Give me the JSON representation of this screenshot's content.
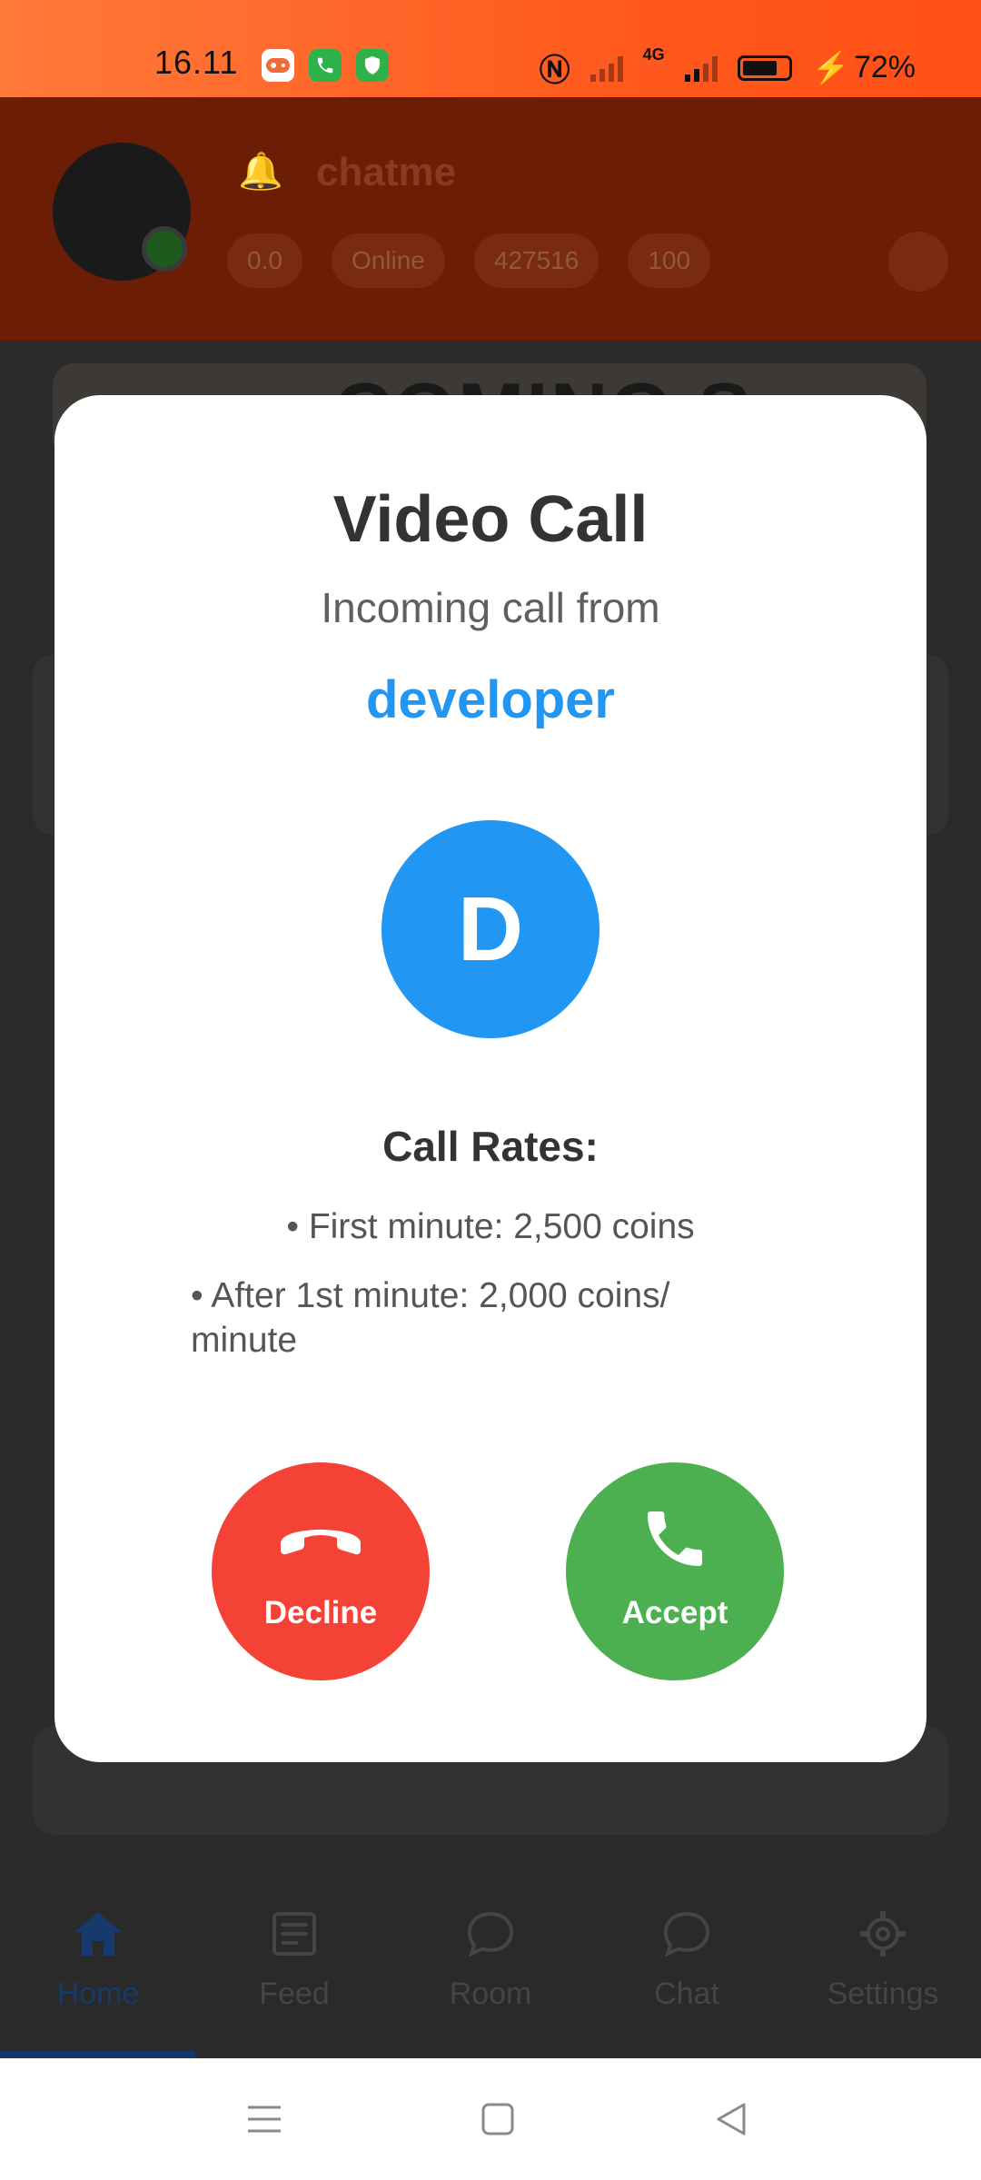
{
  "status_bar": {
    "time": "16.11",
    "battery": "72%",
    "network": "4G"
  },
  "background_app": {
    "title": "chatme",
    "chips": [
      "0.0",
      "Online",
      "427516",
      "100"
    ],
    "banner_text": "COMING S",
    "bottom_nav": [
      {
        "label": "Home",
        "icon": "home-icon",
        "active": true
      },
      {
        "label": "Feed",
        "icon": "feed-icon",
        "active": false
      },
      {
        "label": "Room",
        "icon": "room-icon",
        "active": false
      },
      {
        "label": "Chat",
        "icon": "chat-icon",
        "active": false
      },
      {
        "label": "Settings",
        "icon": "settings-icon",
        "active": false
      }
    ]
  },
  "call_modal": {
    "title": "Video Call",
    "subtitle": "Incoming call from",
    "caller_name": "developer",
    "caller_initial": "D",
    "rates_title": "Call Rates:",
    "rates": [
      "• First minute: 2,500 coins",
      "• After 1st minute: 2,000 coins/ minute"
    ],
    "decline_label": "Decline",
    "accept_label": "Accept"
  },
  "colors": {
    "accent_blue": "#2196f3",
    "decline_red": "#f44336",
    "accept_green": "#4caf50",
    "status_bar_orange": "#ff5a1f"
  }
}
